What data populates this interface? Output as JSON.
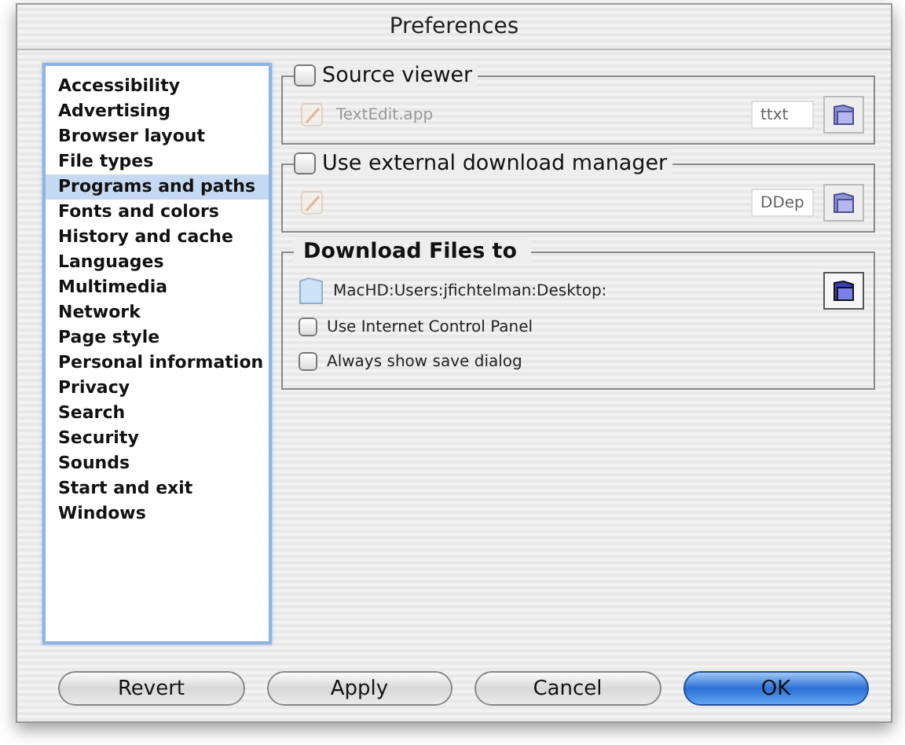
{
  "window": {
    "title": "Preferences"
  },
  "sidebar": {
    "items": [
      {
        "label": "Accessibility",
        "selected": false
      },
      {
        "label": "Advertising",
        "selected": false
      },
      {
        "label": "Browser layout",
        "selected": false
      },
      {
        "label": "File types",
        "selected": false
      },
      {
        "label": "Programs and paths",
        "selected": true
      },
      {
        "label": "Fonts and colors",
        "selected": false
      },
      {
        "label": "History and cache",
        "selected": false
      },
      {
        "label": "Languages",
        "selected": false
      },
      {
        "label": "Multimedia",
        "selected": false
      },
      {
        "label": "Network",
        "selected": false
      },
      {
        "label": "Page style",
        "selected": false
      },
      {
        "label": "Personal information",
        "selected": false
      },
      {
        "label": "Privacy",
        "selected": false
      },
      {
        "label": "Search",
        "selected": false
      },
      {
        "label": "Security",
        "selected": false
      },
      {
        "label": "Sounds",
        "selected": false
      },
      {
        "label": "Start and exit",
        "selected": false
      },
      {
        "label": "Windows",
        "selected": false
      }
    ]
  },
  "app_groups": [
    {
      "label": "Source viewer",
      "checked": false,
      "app": "TextEdit.app",
      "type_code": "ttxt"
    },
    {
      "label": "Use external download manager",
      "checked": false,
      "type_code": "DDep"
    }
  ],
  "download": {
    "title": "Download Files to",
    "path": "MacHD:Users:jfichtelman:Desktop:",
    "options": [
      {
        "label": "Use Internet Control Panel",
        "checked": false
      },
      {
        "label": "Always show save dialog",
        "checked": false
      }
    ]
  },
  "buttons": [
    {
      "label": "Revert",
      "default": false
    },
    {
      "label": "Apply",
      "default": false
    },
    {
      "label": "Cancel",
      "default": false
    },
    {
      "label": "OK",
      "default": true
    }
  ]
}
